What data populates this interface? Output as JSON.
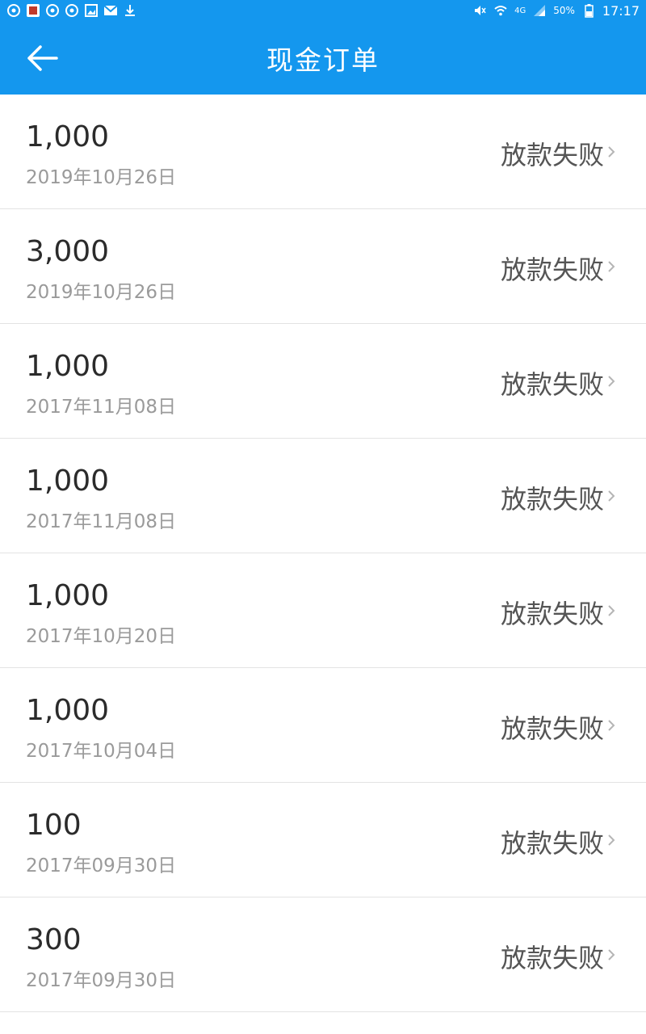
{
  "status_bar": {
    "battery": "50%",
    "network": "4G",
    "time": "17:17",
    "icons_left": [
      "chat-icon",
      "app-notification-icon",
      "chat-icon",
      "chat-icon",
      "image-icon",
      "mail-icon",
      "download-icon"
    ],
    "icons_right": [
      "mute-icon",
      "wifi-icon",
      "signal-icon",
      "battery-icon"
    ]
  },
  "header": {
    "title": "现金订单",
    "back_icon": "arrow-left-icon"
  },
  "colors": {
    "primary": "#1497ee",
    "amount_text": "#2b2b2b",
    "date_text": "#9a9a9a",
    "status_text": "#555555",
    "divider": "#e3e3e3"
  },
  "orders": [
    {
      "amount": "1,000",
      "date": "2019年10月26日",
      "status": "放款失败"
    },
    {
      "amount": "3,000",
      "date": "2019年10月26日",
      "status": "放款失败"
    },
    {
      "amount": "1,000",
      "date": "2017年11月08日",
      "status": "放款失败"
    },
    {
      "amount": "1,000",
      "date": "2017年11月08日",
      "status": "放款失败"
    },
    {
      "amount": "1,000",
      "date": "2017年10月20日",
      "status": "放款失败"
    },
    {
      "amount": "1,000",
      "date": "2017年10月04日",
      "status": "放款失败"
    },
    {
      "amount": "100",
      "date": "2017年09月30日",
      "status": "放款失败"
    },
    {
      "amount": "300",
      "date": "2017年09月30日",
      "status": "放款失败"
    }
  ]
}
